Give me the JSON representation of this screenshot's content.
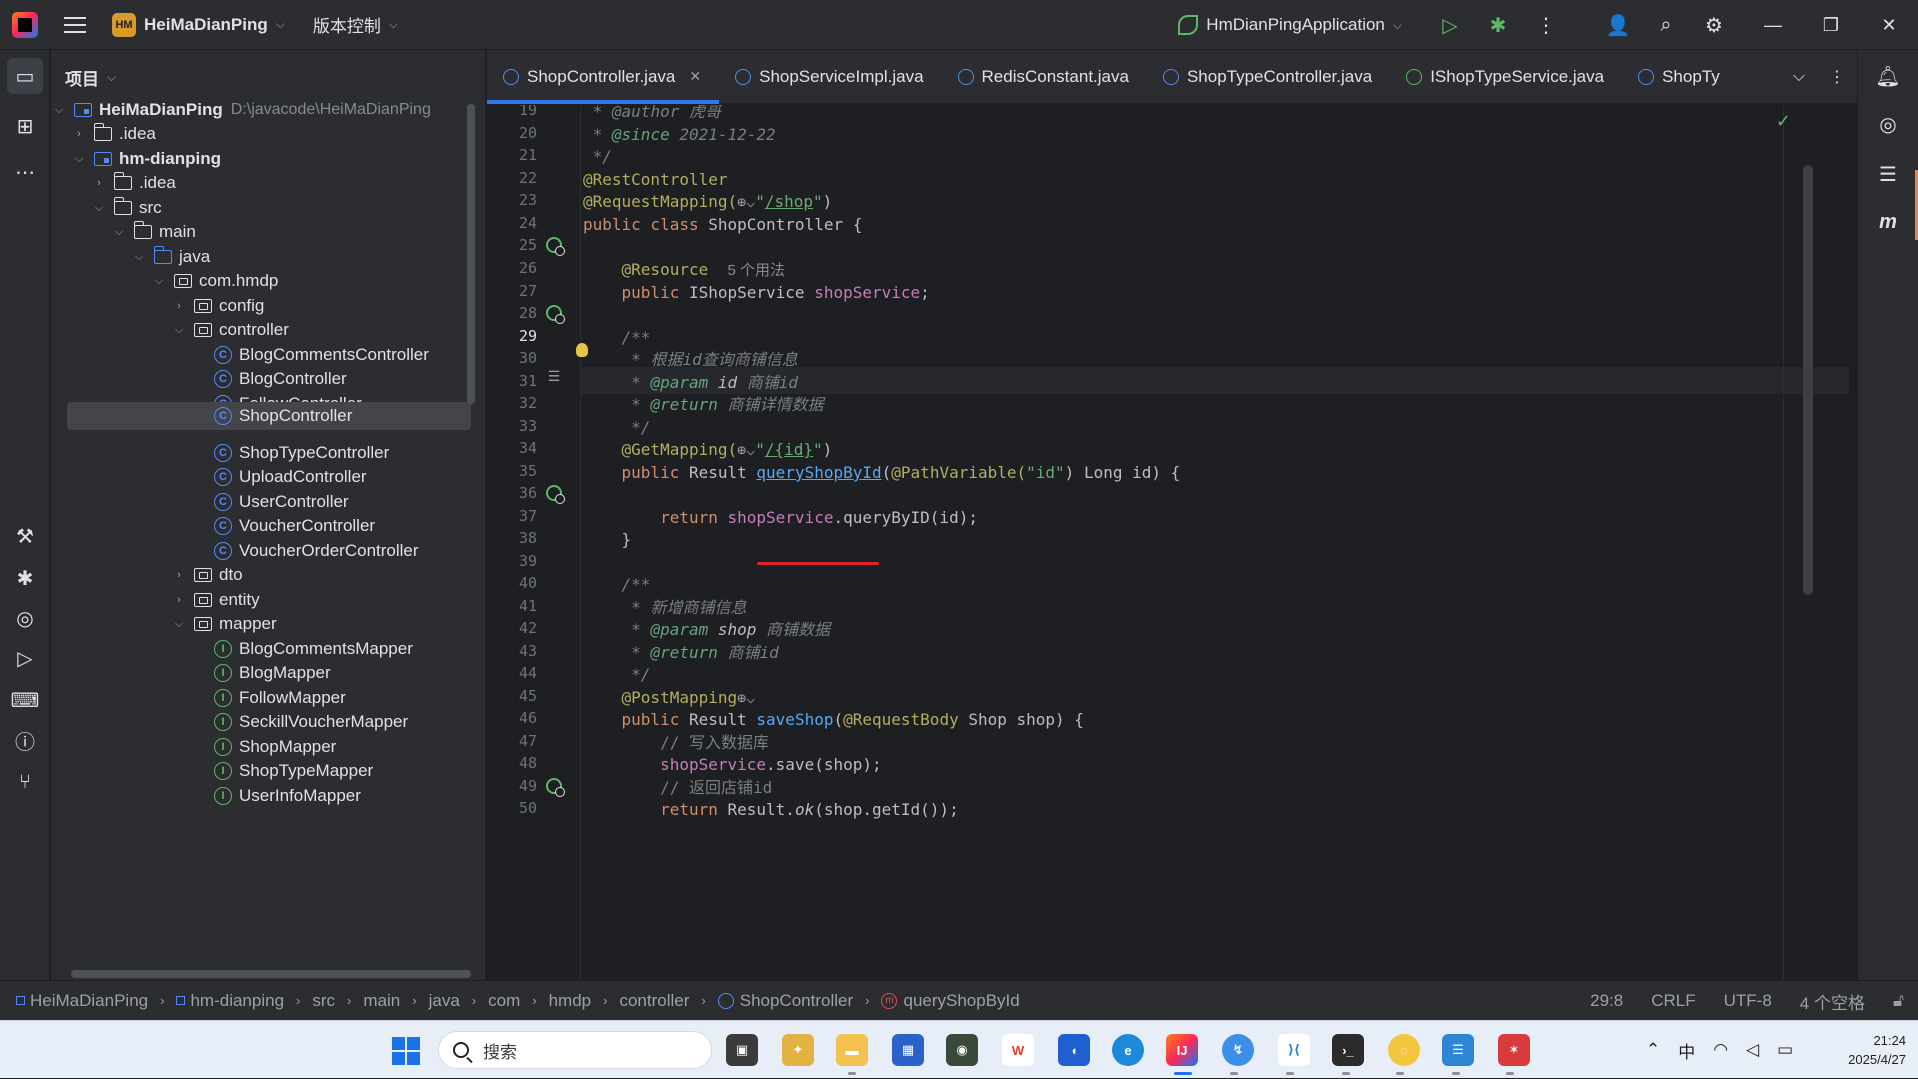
{
  "titlebar": {
    "project_badge": "HM",
    "project_name": "HeiMaDianPing",
    "vcs_label": "版本控制",
    "run_config": "HmDianPingApplication"
  },
  "project_panel": {
    "title": "项目",
    "tree": [
      {
        "label": "HeiMaDianPing",
        "path": "D:\\javacode\\HeiMaDianPing"
      },
      {
        "label": ".idea"
      },
      {
        "label": "hm-dianping"
      },
      {
        "label": ".idea"
      },
      {
        "label": "src"
      },
      {
        "label": "main"
      },
      {
        "label": "java"
      },
      {
        "label": "com.hmdp"
      },
      {
        "label": "config"
      },
      {
        "label": "controller"
      },
      {
        "label": "BlogCommentsController"
      },
      {
        "label": "BlogController"
      },
      {
        "label": "FollowController"
      },
      {
        "label": "ShopController"
      },
      {
        "label": "ShopTypeController"
      },
      {
        "label": "UploadController"
      },
      {
        "label": "UserController"
      },
      {
        "label": "VoucherController"
      },
      {
        "label": "VoucherOrderController"
      },
      {
        "label": "dto"
      },
      {
        "label": "entity"
      },
      {
        "label": "mapper"
      },
      {
        "label": "BlogCommentsMapper"
      },
      {
        "label": "BlogMapper"
      },
      {
        "label": "FollowMapper"
      },
      {
        "label": "SeckillVoucherMapper"
      },
      {
        "label": "ShopMapper"
      },
      {
        "label": "ShopTypeMapper"
      },
      {
        "label": "UserInfoMapper"
      }
    ]
  },
  "tabs": [
    {
      "label": "ShopController.java",
      "active": true
    },
    {
      "label": "ShopServiceImpl.java"
    },
    {
      "label": "RedisConstant.java"
    },
    {
      "label": "ShopTypeController.java"
    },
    {
      "label": "IShopTypeService.java"
    },
    {
      "label": "ShopTy"
    }
  ],
  "editor": {
    "line_numbers": [
      "19",
      "20",
      "21",
      "22",
      "23",
      "24",
      "25",
      "26",
      "27",
      "28",
      "29",
      "30",
      "31",
      "32",
      "33",
      "34",
      "35",
      "36",
      "37",
      "38",
      "39",
      "40",
      "41",
      "42",
      "43",
      "44",
      "45",
      "46",
      "47",
      "48",
      "49",
      "50"
    ],
    "current_line": "29",
    "code": {
      "l19": "@author 虎哥",
      "l20_tag": "@since",
      "l20_val": "2021-12-22",
      "l22": "@RestController",
      "l23_ann": "@RequestMapping(",
      "l23_url": "/shop",
      "l24": "public class ShopController {",
      "l26_ann": "@Resource",
      "l26_hint": "5 个用法",
      "l27_kw": "public",
      "l27_type": "IShopService",
      "l27_field": "shopService",
      "l29": "/**",
      "l30": "根据id查询商铺信息",
      "l31_tag": "@param",
      "l31_name": "id",
      "l31_desc": "商铺id",
      "l32_tag": "@return",
      "l32_desc": "商铺详情数据",
      "l33": "*/",
      "l34_ann": "@GetMapping(",
      "l34_url": "/{id}",
      "l35_method": "queryShopById",
      "l35_ann": "@PathVariable(",
      "l35_str": "\"id\"",
      "l37_field": "shopService",
      "l37_rest": ".queryByID(id);",
      "l40": "/**",
      "l41": "新增商铺信息",
      "l42_tag": "@param",
      "l42_name": "shop",
      "l42_desc": "商铺数据",
      "l43_tag": "@return",
      "l43_desc": "商铺id",
      "l45_ann": "@PostMapping",
      "l46_method": "saveShop",
      "l46_ann": "@RequestBody",
      "l47": "// 写入数据库",
      "l48_field": "shopService",
      "l48_rest": ".save(shop);",
      "l49": "// 返回店铺id",
      "l50_ok": "ok",
      "l50_rest": "(shop.getId());"
    }
  },
  "statusbar": {
    "breadcrumbs": [
      "HeiMaDianPing",
      "hm-dianping",
      "src",
      "main",
      "java",
      "com",
      "hmdp",
      "controller",
      "ShopController",
      "queryShopById"
    ],
    "position": "29:8",
    "line_sep": "CRLF",
    "encoding": "UTF-8",
    "indent": "4 个空格"
  },
  "taskbar": {
    "search_placeholder": "搜索",
    "ime": "中",
    "time": "21:24",
    "date": "2025/4/27"
  }
}
